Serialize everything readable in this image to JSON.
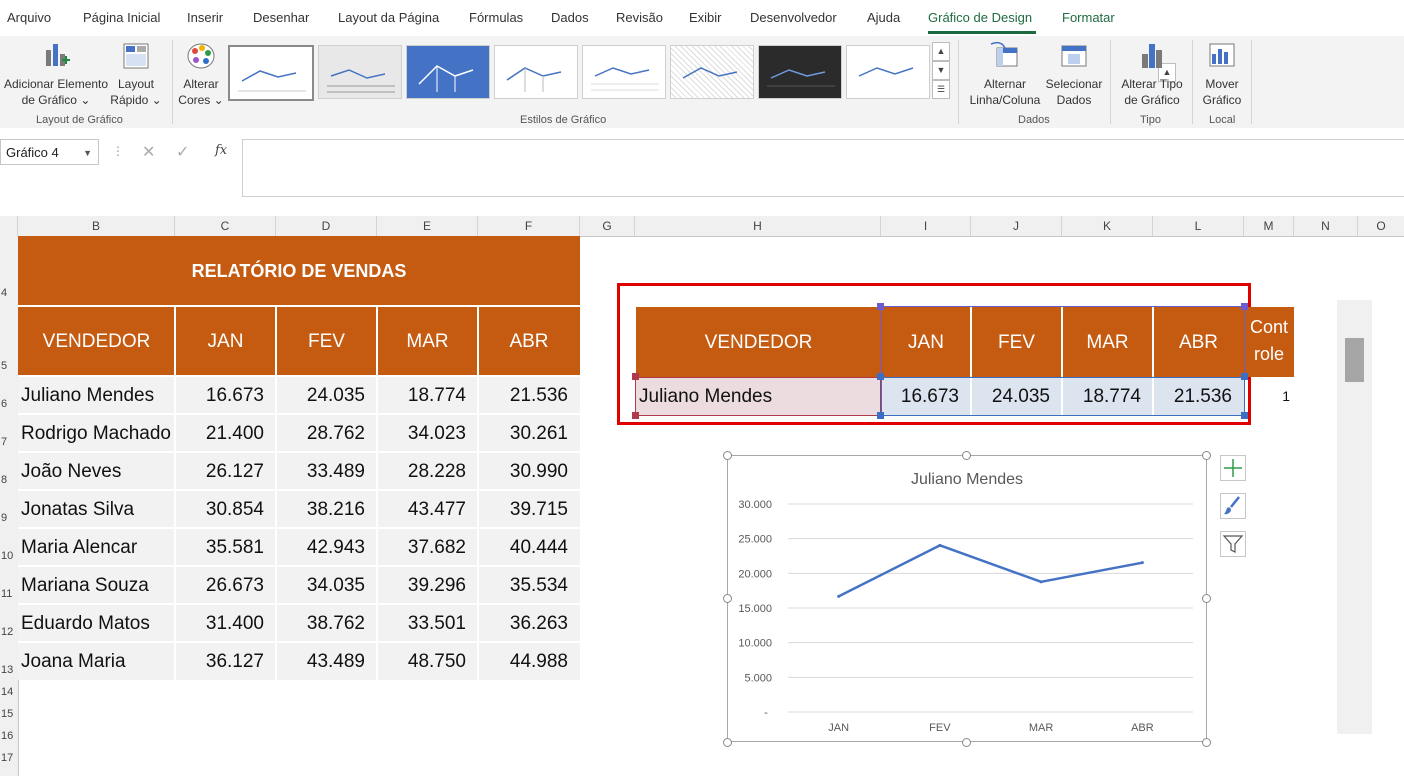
{
  "ribbon_tabs": [
    "Arquivo",
    "Página Inicial",
    "Inserir",
    "Desenhar",
    "Layout da Página",
    "Fórmulas",
    "Dados",
    "Revisão",
    "Exibir",
    "Desenvolvedor",
    "Ajuda",
    "Gráfico de Design",
    "Formatar"
  ],
  "ribbon": {
    "add_element": [
      "Adicionar Elemento",
      "de Gráfico ⌄"
    ],
    "quick_layout": [
      "Layout",
      "Rápido ⌄"
    ],
    "change_colors": [
      "Alterar",
      "Cores ⌄"
    ],
    "switch_row_col": [
      "Alternar",
      "Linha/Coluna"
    ],
    "select_data": [
      "Selecionar",
      "Dados"
    ],
    "change_type": [
      "Alterar Tipo",
      "de Gráfico"
    ],
    "move_chart": [
      "Mover",
      "Gráfico"
    ],
    "group_layout": "Layout de Gráfico",
    "group_styles": "Estilos de Gráfico",
    "group_data": "Dados",
    "group_type": "Tipo",
    "group_location": "Local"
  },
  "formula_bar": {
    "name_box": "Gráfico 4",
    "fx": "fx"
  },
  "columns": [
    "B",
    "C",
    "D",
    "E",
    "F",
    "G",
    "H",
    "I",
    "J",
    "K",
    "L",
    "M",
    "N",
    "O"
  ],
  "rows": [
    "4",
    "5",
    "6",
    "7",
    "8",
    "9",
    "10",
    "11",
    "12",
    "13",
    "14",
    "15",
    "16",
    "17"
  ],
  "report": {
    "title": "RELATÓRIO DE VENDAS",
    "headers": [
      "VENDEDOR",
      "JAN",
      "FEV",
      "MAR",
      "ABR"
    ],
    "rows": [
      [
        "Juliano Mendes",
        "16.673",
        "24.035",
        "18.774",
        "21.536"
      ],
      [
        "Rodrigo Machado",
        "21.400",
        "28.762",
        "34.023",
        "30.261"
      ],
      [
        "João Neves",
        "26.127",
        "33.489",
        "28.228",
        "30.990"
      ],
      [
        "Jonatas Silva",
        "30.854",
        "38.216",
        "43.477",
        "39.715"
      ],
      [
        "Maria Alencar",
        "35.581",
        "42.943",
        "37.682",
        "40.444"
      ],
      [
        "Mariana Souza",
        "26.673",
        "34.035",
        "39.296",
        "35.534"
      ],
      [
        "Eduardo Matos",
        "31.400",
        "38.762",
        "33.501",
        "36.263"
      ],
      [
        "Joana Maria",
        "36.127",
        "43.489",
        "48.750",
        "44.988"
      ]
    ]
  },
  "selection_table": {
    "headers": [
      "VENDEDOR",
      "JAN",
      "FEV",
      "MAR",
      "ABR"
    ],
    "row": [
      "Juliano Mendes",
      "16.673",
      "24.035",
      "18.774",
      "21.536"
    ],
    "control_label_1": "Cont",
    "control_label_2": "role",
    "control_value": "1"
  },
  "colors": {
    "accent_orange": "#c55a11",
    "line_blue": "#4472c4",
    "highlight_box": "#e00000"
  },
  "chart_data": {
    "type": "line",
    "title": "Juliano Mendes",
    "categories": [
      "JAN",
      "FEV",
      "MAR",
      "ABR"
    ],
    "series": [
      {
        "values": [
          16673,
          24035,
          18774,
          21536
        ]
      }
    ],
    "ylim": [
      0,
      30000
    ],
    "yticks": [
      "-",
      "5.000",
      "10.000",
      "15.000",
      "20.000",
      "25.000",
      "30.000"
    ],
    "grid": true,
    "legend": "none"
  }
}
